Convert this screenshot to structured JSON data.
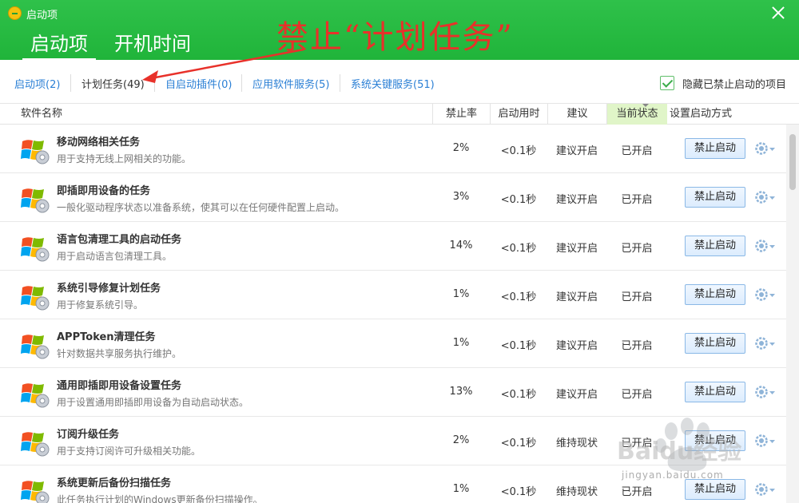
{
  "window": {
    "title": "启动项"
  },
  "header": {
    "tabs": [
      {
        "label": "启动项"
      },
      {
        "label": "开机时间"
      }
    ]
  },
  "annotation": {
    "text": "禁止“计划任务”"
  },
  "subtabs": [
    {
      "label": "启动项(2)"
    },
    {
      "label": "计划任务(49)"
    },
    {
      "label": "自启动插件(0)"
    },
    {
      "label": "应用软件服务(5)"
    },
    {
      "label": "系统关键服务(51)"
    }
  ],
  "hide_disabled": {
    "label": "隐藏已禁止启动的项目",
    "checked": true
  },
  "columns": {
    "name": "软件名称",
    "disable_rate": "禁止率",
    "boot_time": "启动用时",
    "advice": "建议",
    "current_state": "当前状态",
    "start_mode": "设置启动方式"
  },
  "rows": [
    {
      "name": "移动网络相关任务",
      "desc": "用于支持无线上网相关的功能。",
      "rate": "2%",
      "time": "<0.1秒",
      "advice": "建议开启",
      "state": "已开启",
      "action": "禁止启动"
    },
    {
      "name": "即插即用设备的任务",
      "desc": "一般化驱动程序状态以准备系统，使其可以在任何硬件配置上启动。",
      "rate": "3%",
      "time": "<0.1秒",
      "advice": "建议开启",
      "state": "已开启",
      "action": "禁止启动"
    },
    {
      "name": "语言包清理工具的启动任务",
      "desc": "用于启动语言包清理工具。",
      "rate": "14%",
      "time": "<0.1秒",
      "advice": "建议开启",
      "state": "已开启",
      "action": "禁止启动"
    },
    {
      "name": "系统引导修复计划任务",
      "desc": "用于修复系统引导。",
      "rate": "1%",
      "time": "<0.1秒",
      "advice": "建议开启",
      "state": "已开启",
      "action": "禁止启动"
    },
    {
      "name": "APPToken清理任务",
      "desc": "针对数据共享服务执行维护。",
      "rate": "1%",
      "time": "<0.1秒",
      "advice": "建议开启",
      "state": "已开启",
      "action": "禁止启动"
    },
    {
      "name": "通用即插即用设备设置任务",
      "desc": "用于设置通用即插即用设备为自动启动状态。",
      "rate": "13%",
      "time": "<0.1秒",
      "advice": "建议开启",
      "state": "已开启",
      "action": "禁止启动"
    },
    {
      "name": "订阅升级任务",
      "desc": "用于支持订阅许可升级相关功能。",
      "rate": "2%",
      "time": "<0.1秒",
      "advice": "维持现状",
      "state": "已开启",
      "action": "禁止启动"
    },
    {
      "name": "系统更新后备份扫描任务",
      "desc": "此任务执行计划的Windows更新备份扫描操作。",
      "rate": "1%",
      "time": "<0.1秒",
      "advice": "维持现状",
      "state": "已开启",
      "action": "禁止启动"
    }
  ],
  "watermark": {
    "brand": "Baidu经验",
    "url": "jingyan.baidu.com"
  },
  "colors": {
    "header_green": "#2fc14a",
    "link_blue": "#2a7fd5",
    "annotation_red": "#e8312a",
    "current_state_bg": "#e0f5c8"
  },
  "icons": {
    "row_icon": "windows-gear-icon",
    "gear": "gear-dropdown-icon"
  }
}
